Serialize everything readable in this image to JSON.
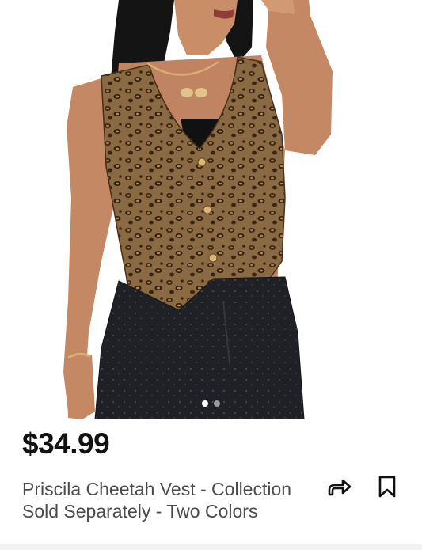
{
  "listing": {
    "price": "$34.99",
    "title": "Priscila Cheetah Vest - Collection Sold Separately - Two Colors",
    "image": {
      "description_icon": "product-photo",
      "total_images": 2,
      "active_index": 0
    }
  },
  "actions": {
    "share_icon": "share-arrow-icon",
    "save_icon": "bookmark-icon"
  },
  "colors": {
    "price_text": "#111111",
    "title_text": "#4a4a4a",
    "leopard_base": "#7a5a35",
    "jeans": "#1e2026",
    "hair": "#141414",
    "skin": "#c98e68"
  }
}
